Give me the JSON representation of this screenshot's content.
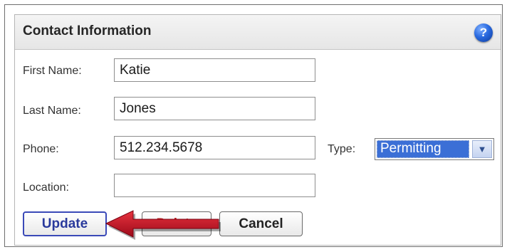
{
  "panel": {
    "title": "Contact Information",
    "help_icon": "?"
  },
  "form": {
    "first_name": {
      "label": "First Name:",
      "value": "Katie"
    },
    "last_name": {
      "label": "Last Name:",
      "value": "Jones"
    },
    "phone": {
      "label": "Phone:",
      "value": "512.234.5678"
    },
    "location": {
      "label": "Location:",
      "value": ""
    },
    "type": {
      "label": "Type:",
      "selected": "Permitting"
    }
  },
  "buttons": {
    "update": "Update",
    "delete": "Delete",
    "cancel": "Cancel"
  },
  "icons": {
    "help": "help-icon",
    "dropdown": "chevron-down-icon",
    "annotation": "red-arrow"
  },
  "colors": {
    "accent": "#3b6fd6",
    "update_border": "#3a49b8",
    "delete_text": "#c22020",
    "arrow": "#c8102e"
  }
}
